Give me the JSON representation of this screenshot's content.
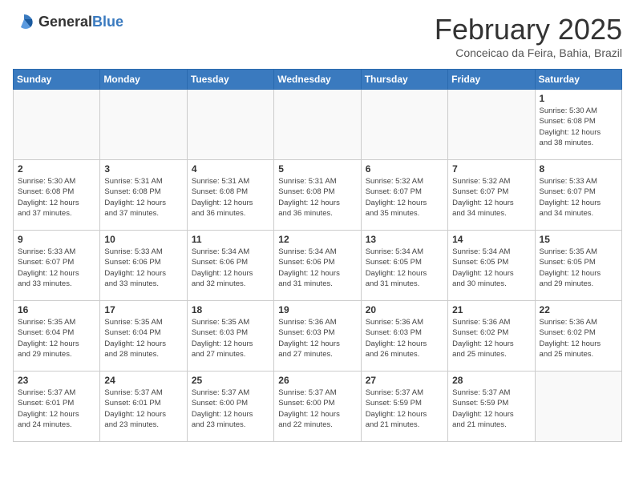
{
  "header": {
    "logo_general": "General",
    "logo_blue": "Blue",
    "month_title": "February 2025",
    "location": "Conceicao da Feira, Bahia, Brazil"
  },
  "days_of_week": [
    "Sunday",
    "Monday",
    "Tuesday",
    "Wednesday",
    "Thursday",
    "Friday",
    "Saturday"
  ],
  "weeks": [
    [
      {
        "day": "",
        "info": ""
      },
      {
        "day": "",
        "info": ""
      },
      {
        "day": "",
        "info": ""
      },
      {
        "day": "",
        "info": ""
      },
      {
        "day": "",
        "info": ""
      },
      {
        "day": "",
        "info": ""
      },
      {
        "day": "1",
        "info": "Sunrise: 5:30 AM\nSunset: 6:08 PM\nDaylight: 12 hours\nand 38 minutes."
      }
    ],
    [
      {
        "day": "2",
        "info": "Sunrise: 5:30 AM\nSunset: 6:08 PM\nDaylight: 12 hours\nand 37 minutes."
      },
      {
        "day": "3",
        "info": "Sunrise: 5:31 AM\nSunset: 6:08 PM\nDaylight: 12 hours\nand 37 minutes."
      },
      {
        "day": "4",
        "info": "Sunrise: 5:31 AM\nSunset: 6:08 PM\nDaylight: 12 hours\nand 36 minutes."
      },
      {
        "day": "5",
        "info": "Sunrise: 5:31 AM\nSunset: 6:08 PM\nDaylight: 12 hours\nand 36 minutes."
      },
      {
        "day": "6",
        "info": "Sunrise: 5:32 AM\nSunset: 6:07 PM\nDaylight: 12 hours\nand 35 minutes."
      },
      {
        "day": "7",
        "info": "Sunrise: 5:32 AM\nSunset: 6:07 PM\nDaylight: 12 hours\nand 34 minutes."
      },
      {
        "day": "8",
        "info": "Sunrise: 5:33 AM\nSunset: 6:07 PM\nDaylight: 12 hours\nand 34 minutes."
      }
    ],
    [
      {
        "day": "9",
        "info": "Sunrise: 5:33 AM\nSunset: 6:07 PM\nDaylight: 12 hours\nand 33 minutes."
      },
      {
        "day": "10",
        "info": "Sunrise: 5:33 AM\nSunset: 6:06 PM\nDaylight: 12 hours\nand 33 minutes."
      },
      {
        "day": "11",
        "info": "Sunrise: 5:34 AM\nSunset: 6:06 PM\nDaylight: 12 hours\nand 32 minutes."
      },
      {
        "day": "12",
        "info": "Sunrise: 5:34 AM\nSunset: 6:06 PM\nDaylight: 12 hours\nand 31 minutes."
      },
      {
        "day": "13",
        "info": "Sunrise: 5:34 AM\nSunset: 6:05 PM\nDaylight: 12 hours\nand 31 minutes."
      },
      {
        "day": "14",
        "info": "Sunrise: 5:34 AM\nSunset: 6:05 PM\nDaylight: 12 hours\nand 30 minutes."
      },
      {
        "day": "15",
        "info": "Sunrise: 5:35 AM\nSunset: 6:05 PM\nDaylight: 12 hours\nand 29 minutes."
      }
    ],
    [
      {
        "day": "16",
        "info": "Sunrise: 5:35 AM\nSunset: 6:04 PM\nDaylight: 12 hours\nand 29 minutes."
      },
      {
        "day": "17",
        "info": "Sunrise: 5:35 AM\nSunset: 6:04 PM\nDaylight: 12 hours\nand 28 minutes."
      },
      {
        "day": "18",
        "info": "Sunrise: 5:35 AM\nSunset: 6:03 PM\nDaylight: 12 hours\nand 27 minutes."
      },
      {
        "day": "19",
        "info": "Sunrise: 5:36 AM\nSunset: 6:03 PM\nDaylight: 12 hours\nand 27 minutes."
      },
      {
        "day": "20",
        "info": "Sunrise: 5:36 AM\nSunset: 6:03 PM\nDaylight: 12 hours\nand 26 minutes."
      },
      {
        "day": "21",
        "info": "Sunrise: 5:36 AM\nSunset: 6:02 PM\nDaylight: 12 hours\nand 25 minutes."
      },
      {
        "day": "22",
        "info": "Sunrise: 5:36 AM\nSunset: 6:02 PM\nDaylight: 12 hours\nand 25 minutes."
      }
    ],
    [
      {
        "day": "23",
        "info": "Sunrise: 5:37 AM\nSunset: 6:01 PM\nDaylight: 12 hours\nand 24 minutes."
      },
      {
        "day": "24",
        "info": "Sunrise: 5:37 AM\nSunset: 6:01 PM\nDaylight: 12 hours\nand 23 minutes."
      },
      {
        "day": "25",
        "info": "Sunrise: 5:37 AM\nSunset: 6:00 PM\nDaylight: 12 hours\nand 23 minutes."
      },
      {
        "day": "26",
        "info": "Sunrise: 5:37 AM\nSunset: 6:00 PM\nDaylight: 12 hours\nand 22 minutes."
      },
      {
        "day": "27",
        "info": "Sunrise: 5:37 AM\nSunset: 5:59 PM\nDaylight: 12 hours\nand 21 minutes."
      },
      {
        "day": "28",
        "info": "Sunrise: 5:37 AM\nSunset: 5:59 PM\nDaylight: 12 hours\nand 21 minutes."
      },
      {
        "day": "",
        "info": ""
      }
    ]
  ]
}
